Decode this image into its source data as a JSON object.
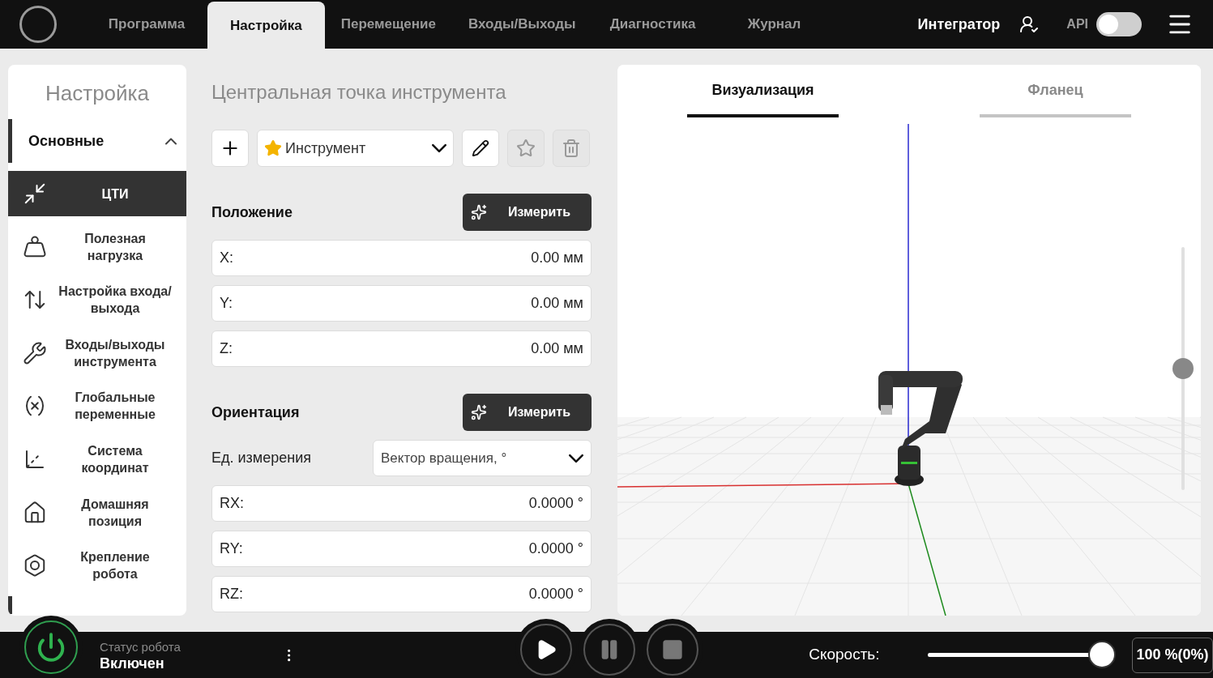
{
  "top_bar": {
    "tabs": [
      {
        "label": "Программа",
        "selected": false
      },
      {
        "label": "Настройка",
        "selected": true
      },
      {
        "label": "Перемещение",
        "selected": false
      },
      {
        "label": "Входы/Выходы",
        "selected": false
      },
      {
        "label": "Диагностика",
        "selected": false
      },
      {
        "label": "Журнал",
        "selected": false
      }
    ],
    "user": "Интегратор",
    "api": {
      "label": "API",
      "on": false
    }
  },
  "sidebar": {
    "title": "Настройка",
    "group": {
      "label": "Основные",
      "expanded": true
    },
    "items": [
      {
        "label": "ЦТИ",
        "selected": true
      },
      {
        "label": "Полезная нагрузка",
        "selected": false
      },
      {
        "label": "Настройка входа/ выхода",
        "selected": false
      },
      {
        "label": "Входы/выходы инструмента",
        "selected": false
      },
      {
        "label": "Глобальные переменные",
        "selected": false
      },
      {
        "label": "Система координат",
        "selected": false
      },
      {
        "label": "Домашняя позиция",
        "selected": false
      },
      {
        "label": "Крепление робота",
        "selected": false
      }
    ]
  },
  "tcp": {
    "title": "Центральная точка инструмента",
    "tool": "Инструмент",
    "position": {
      "title": "Положение",
      "button": "Измерить",
      "fields": [
        {
          "label": "X:",
          "value": "0.00 мм"
        },
        {
          "label": "Y:",
          "value": "0.00 мм"
        },
        {
          "label": "Z:",
          "value": "0.00 мм"
        }
      ]
    },
    "orientation": {
      "title": "Ориентация",
      "button": "Измерить",
      "unit_label": "Ед. измерения",
      "unit": "Вектор вращения, °",
      "fields": [
        {
          "label": "RX:",
          "value": "0.0000 °"
        },
        {
          "label": "RY:",
          "value": "0.0000 °"
        },
        {
          "label": "RZ:",
          "value": "0.0000 °"
        }
      ]
    }
  },
  "view": {
    "tabs": [
      {
        "label": "Визуализация",
        "selected": true
      },
      {
        "label": "Фланец",
        "selected": false
      }
    ],
    "zoom": {
      "level": 0.5
    }
  },
  "status_bar": {
    "status_label": "Статус робота",
    "status": "Включен",
    "speed_label": "Скорость:",
    "speed": {
      "level": 1
    },
    "speed_value": "100 %(0%)"
  }
}
